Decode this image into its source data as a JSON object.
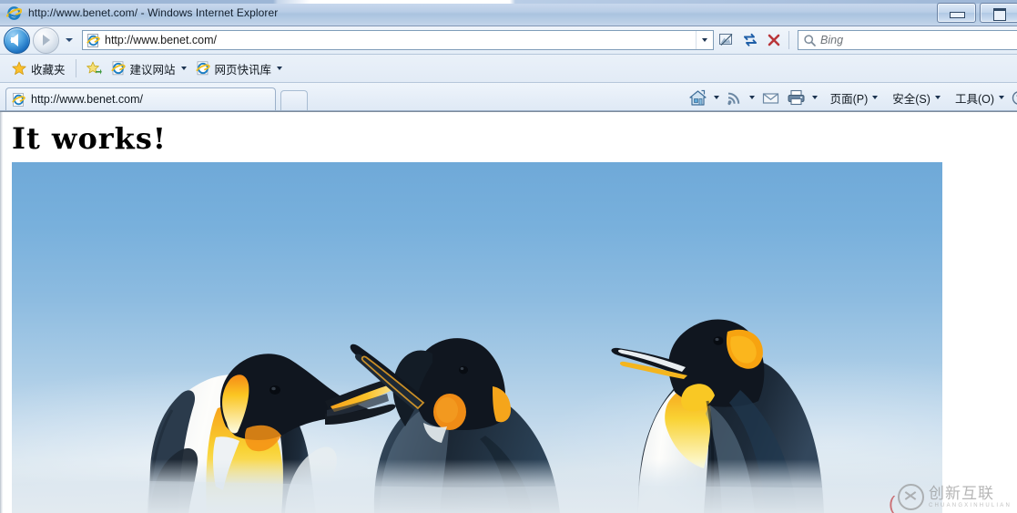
{
  "window": {
    "title": "http://www.benet.com/ - Windows Internet Explorer",
    "minimize_label": "minimize",
    "maximize_label": "maximize"
  },
  "navbar": {
    "back_label": "Back",
    "forward_label": "Forward",
    "recent_pages_label": "Recent Pages",
    "address_value": "http://www.benet.com/",
    "address_dropdown_label": "Address dropdown",
    "compatibility_label": "Compatibility View",
    "refresh_label": "Refresh",
    "stop_label": "Stop",
    "search_placeholder": "Bing"
  },
  "favbar": {
    "favorites_label": "收藏夹",
    "items": [
      {
        "label": "建议网站",
        "icon": "ie-icon",
        "has_caret": true
      },
      {
        "label": "网页快讯库",
        "icon": "ie-icon",
        "has_caret": true
      }
    ]
  },
  "tabs": {
    "items": [
      {
        "title": "http://www.benet.com/",
        "icon": "ie-icon"
      }
    ],
    "newtab_label": "New Tab"
  },
  "commandbar": {
    "home_label": "主页",
    "feeds_label": "源",
    "mail_label": "阅读邮件",
    "print_label": "打印",
    "menus": [
      {
        "label": "页面(P)"
      },
      {
        "label": "安全(S)"
      },
      {
        "label": "工具(O)"
      }
    ],
    "help_label": "帮助"
  },
  "page": {
    "heading": "It works!",
    "image_alt": "Three king penguins against a blue sky"
  },
  "watermark": {
    "cn": "创新互联",
    "en": "CHUANGXINHULIAN"
  },
  "colors": {
    "chrome_blue": "#aac3df",
    "toolbar_light": "#e4edf7",
    "page_white": "#ffffff",
    "sky_blue": "#78b0dc",
    "penguin_yellow": "#f7c51e",
    "penguin_orange": "#f08b1c",
    "penguin_black": "#10161f"
  }
}
